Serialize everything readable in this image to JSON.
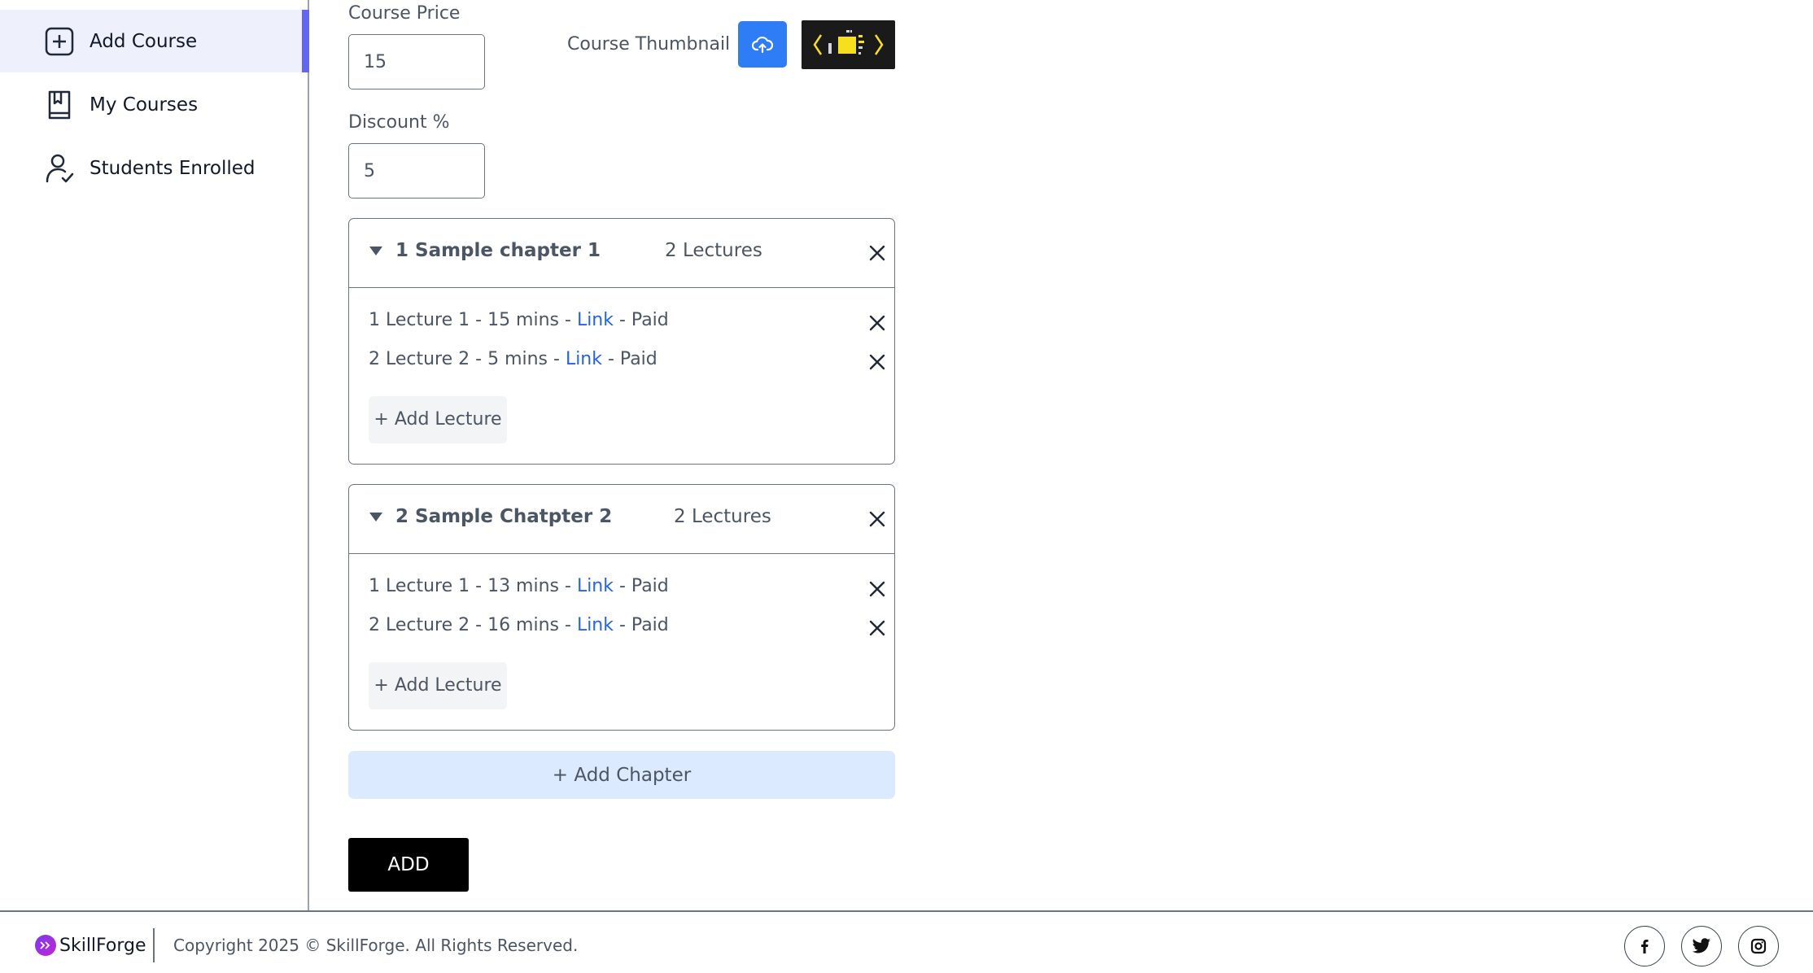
{
  "sidebar": {
    "items": [
      {
        "label": "Add Course",
        "icon": "add-square-icon",
        "active": true
      },
      {
        "label": "My Courses",
        "icon": "book-icon"
      },
      {
        "label": "Students Enrolled",
        "icon": "user-check-icon"
      }
    ]
  },
  "form": {
    "price_label": "Course Price",
    "price_value": "15",
    "thumbnail_label": "Course Thumbnail",
    "upload_icon": "upload-cloud-icon",
    "discount_label": "Discount %",
    "discount_value": "5"
  },
  "chapters": [
    {
      "title": "1 Sample chapter 1",
      "count": "2 Lectures",
      "lectures": [
        {
          "prefix": "1 Lecture 1 - 15 mins - ",
          "link": "Link",
          "suffix": " - Paid"
        },
        {
          "prefix": "2 Lecture 2 - 5 mins - ",
          "link": "Link",
          "suffix": " - Paid"
        }
      ],
      "add_lecture": "+ Add Lecture"
    },
    {
      "title": "2 Sample Chatpter 2",
      "count": "2 Lectures",
      "lectures": [
        {
          "prefix": "1 Lecture 1 - 13 mins - ",
          "link": "Link",
          "suffix": " - Paid"
        },
        {
          "prefix": "2 Lecture 2 - 16 mins - ",
          "link": "Link",
          "suffix": " - Paid"
        }
      ],
      "add_lecture": "+ Add Lecture"
    }
  ],
  "add_chapter": "+ Add Chapter",
  "submit": "ADD",
  "footer": {
    "brand": "SkillForge",
    "copyright": "Copyright 2025 © SkillForge. All Rights Reserved.",
    "social": [
      "facebook-icon",
      "twitter-icon",
      "instagram-icon"
    ]
  },
  "colors": {
    "accent": "#6366f1",
    "active_bg": "#eef0fb",
    "upload": "#2f7df6",
    "link": "#2563eb",
    "add_chapter_bg": "#dbeafe"
  }
}
